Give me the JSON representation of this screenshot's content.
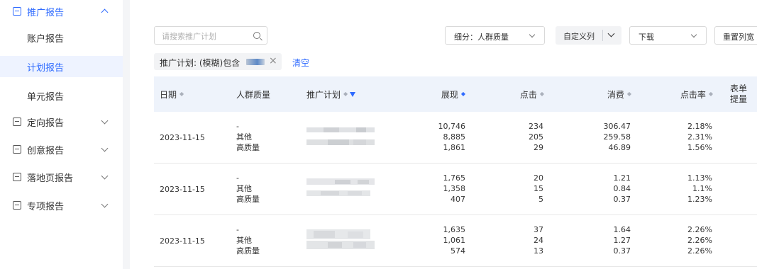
{
  "sidebar": {
    "report_group": "推广报告",
    "sub_items": [
      "账户报告",
      "计划报告",
      "单元报告"
    ],
    "groups": [
      "定向报告",
      "创意报告",
      "落地页报告",
      "专项报告"
    ]
  },
  "toolbar": {
    "search_placeholder": "请搜索推广计划",
    "breakdown_label": "细分：人群质量",
    "custom_columns": "自定义列",
    "download": "下载",
    "reset_columns": "重置列宽"
  },
  "filter": {
    "chip_label": "推广计划: (模糊)包含",
    "close": "×",
    "clear": "清空"
  },
  "table": {
    "headers": {
      "date": "日期",
      "audience": "人群质量",
      "plan": "推广计划",
      "impressions": "展现",
      "clicks": "点击",
      "spend": "消费",
      "ctr": "点击率",
      "form": "表单提量"
    },
    "rows": [
      {
        "date": "2023-11-15",
        "audience": [
          "-",
          "其他",
          "高质量"
        ],
        "impressions": [
          "10,746",
          "8,885",
          "1,861"
        ],
        "clicks": [
          "234",
          "205",
          "29"
        ],
        "spend": [
          "306.47",
          "259.58",
          "46.89"
        ],
        "ctr": [
          "2.18%",
          "2.31%",
          "1.56%"
        ]
      },
      {
        "date": "2023-11-15",
        "audience": [
          "-",
          "其他",
          "高质量"
        ],
        "impressions": [
          "1,765",
          "1,358",
          "407"
        ],
        "clicks": [
          "20",
          "15",
          "5"
        ],
        "spend": [
          "1.21",
          "0.84",
          "0.37"
        ],
        "ctr": [
          "1.13%",
          "1.1%",
          "1.23%"
        ]
      },
      {
        "date": "2023-11-15",
        "audience": [
          "-",
          "其他",
          "高质量"
        ],
        "impressions": [
          "1,635",
          "1,061",
          "574"
        ],
        "clicks": [
          "37",
          "24",
          "13"
        ],
        "spend": [
          "1.64",
          "1.27",
          "0.37"
        ],
        "ctr": [
          "2.26%",
          "2.26%",
          "2.26%"
        ]
      }
    ]
  },
  "colors": {
    "accent": "#2f6bff",
    "header_bg": "#eef3fb",
    "selected_bg": "#eef3ff"
  }
}
